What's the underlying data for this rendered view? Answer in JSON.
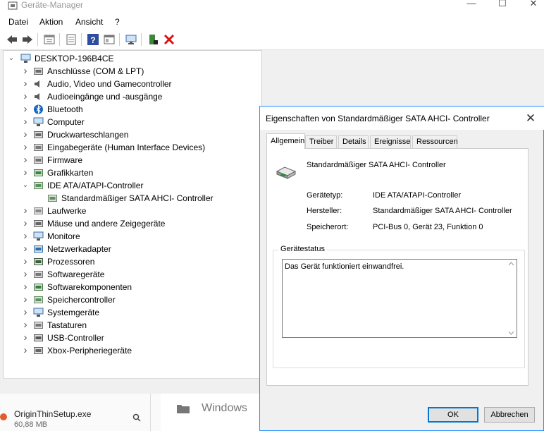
{
  "window": {
    "title": "Geräte-Manager",
    "minimize_glyph": "—",
    "maximize_glyph": "☐",
    "close_glyph": "✕"
  },
  "menu": [
    "Datei",
    "Aktion",
    "Ansicht",
    "?"
  ],
  "toolbar": {
    "icons": [
      "back-icon",
      "forward-icon",
      "properties-grid-icon",
      "update-driver-icon",
      "help-icon",
      "view-grid-icon",
      "monitor-icon",
      "add-driver-icon",
      "uninstall-icon"
    ]
  },
  "tree": {
    "root": "DESKTOP-196B4CE",
    "items": [
      {
        "label": "Anschlüsse (COM & LPT)",
        "icon": "ports-icon",
        "expanded": false
      },
      {
        "label": "Audio, Video und Gamecontroller",
        "icon": "speaker-icon",
        "expanded": false
      },
      {
        "label": "Audioeingänge und -ausgänge",
        "icon": "speaker-icon",
        "expanded": false
      },
      {
        "label": "Bluetooth",
        "icon": "bluetooth-icon",
        "expanded": false
      },
      {
        "label": "Computer",
        "icon": "computer-icon",
        "expanded": false
      },
      {
        "label": "Druckwarteschlangen",
        "icon": "printer-icon",
        "expanded": false
      },
      {
        "label": "Eingabegeräte (Human Interface Devices)",
        "icon": "hid-icon",
        "expanded": false
      },
      {
        "label": "Firmware",
        "icon": "firmware-icon",
        "expanded": false
      },
      {
        "label": "Grafikkarten",
        "icon": "display-adapter-icon",
        "expanded": false
      },
      {
        "label": "IDE ATA/ATAPI-Controller",
        "icon": "ide-controller-icon",
        "expanded": true
      },
      {
        "label": "Standardmäßiger SATA AHCI- Controller",
        "icon": "ide-controller-icon",
        "child": true
      },
      {
        "label": "Laufwerke",
        "icon": "drive-icon",
        "expanded": false
      },
      {
        "label": "Mäuse und andere Zeigegeräte",
        "icon": "mouse-icon",
        "expanded": false
      },
      {
        "label": "Monitore",
        "icon": "monitor-icon",
        "expanded": false
      },
      {
        "label": "Netzwerkadapter",
        "icon": "network-adapter-icon",
        "expanded": false
      },
      {
        "label": "Prozessoren",
        "icon": "processor-icon",
        "expanded": false
      },
      {
        "label": "Softwaregeräte",
        "icon": "software-device-icon",
        "expanded": false
      },
      {
        "label": "Softwarekomponenten",
        "icon": "software-component-icon",
        "expanded": false
      },
      {
        "label": "Speichercontroller",
        "icon": "storage-controller-icon",
        "expanded": false
      },
      {
        "label": "Systemgeräte",
        "icon": "system-device-icon",
        "expanded": false
      },
      {
        "label": "Tastaturen",
        "icon": "keyboard-icon",
        "expanded": false
      },
      {
        "label": "USB-Controller",
        "icon": "usb-icon",
        "expanded": false
      },
      {
        "label": "Xbox-Peripheriegeräte",
        "icon": "xbox-icon",
        "expanded": false
      }
    ]
  },
  "taskbar_fragment": {
    "download_name": "OriginThinSetup.exe",
    "download_size": "60,88 MB",
    "folder_label": "Windows"
  },
  "dialog": {
    "title": "Eigenschaften von Standardmäßiger SATA AHCI- Controller",
    "close_glyph": "✕",
    "tabs": [
      "Allgemein",
      "Treiber",
      "Details",
      "Ereignisse",
      "Ressourcen"
    ],
    "active_tab": "Allgemein",
    "device_name": "Standardmäßiger SATA AHCI- Controller",
    "properties": [
      {
        "label": "Gerätetyp:",
        "value": "IDE ATA/ATAPI-Controller"
      },
      {
        "label": "Hersteller:",
        "value": "Standardmäßiger SATA AHCI- Controller"
      },
      {
        "label": "Speicherort:",
        "value": "PCI-Bus 0, Gerät 23, Funktion 0"
      }
    ],
    "status_group_label": "Gerätestatus",
    "status_text": "Das Gerät funktioniert einwandfrei.",
    "ok_label": "OK",
    "cancel_label": "Abbrechen"
  }
}
